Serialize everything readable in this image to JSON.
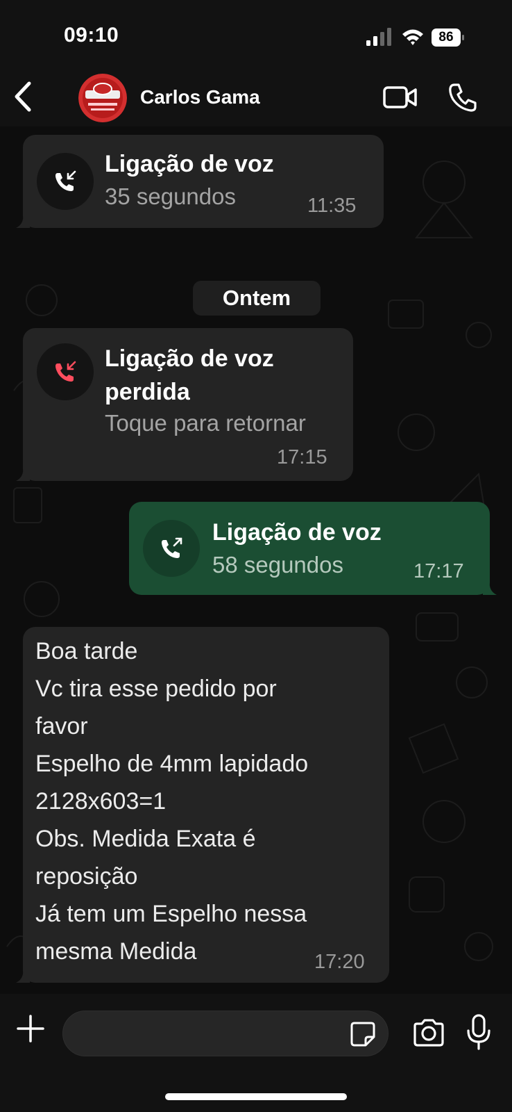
{
  "status_bar": {
    "time": "09:10",
    "battery": "86"
  },
  "header": {
    "contact_name": "Carlos Gama",
    "back_icon": "chevron-left-icon",
    "video_icon": "video-camera-icon",
    "call_icon": "phone-icon"
  },
  "messages": [
    {
      "type": "call",
      "direction": "incoming",
      "title": "Ligação de voz",
      "subtitle": "35 segundos",
      "time": "11:35",
      "icon": "incoming-call-icon"
    },
    {
      "type": "date",
      "label": "Ontem"
    },
    {
      "type": "call",
      "direction": "incoming",
      "missed": true,
      "title_line1": "Ligação de voz",
      "title_line2": "perdida",
      "subtitle": "Toque para retornar",
      "time": "17:15",
      "icon": "missed-call-icon"
    },
    {
      "type": "call",
      "direction": "outgoing",
      "title": "Ligação de voz",
      "subtitle": "58 segundos",
      "time": "17:17",
      "icon": "outgoing-call-icon"
    },
    {
      "type": "text",
      "direction": "incoming",
      "lines": [
        "Boa tarde",
        "Vc tira esse pedido por",
        "favor",
        "Espelho de 4mm lapidado",
        "2128x603=1",
        "Obs. Medida Exata é",
        "reposição",
        "Já tem um Espelho nessa",
        "mesma Medida"
      ],
      "time": "17:20"
    }
  ],
  "composer": {
    "input_value": "",
    "icons": [
      "plus-icon",
      "sticker-icon",
      "camera-icon",
      "microphone-icon"
    ]
  },
  "colors": {
    "incoming_bubble": "#242424",
    "outgoing_bubble": "#1b4e33",
    "missed_call": "#ff4d5e",
    "background": "#0b0b0b"
  }
}
